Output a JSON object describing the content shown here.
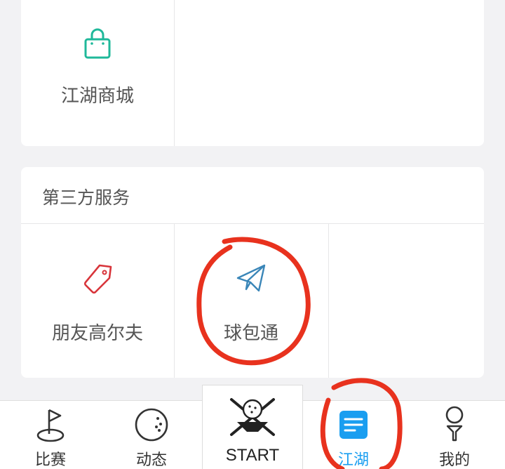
{
  "mall": {
    "label": "江湖商城",
    "icon": "shopping-bag-icon",
    "color": "#1fb89a"
  },
  "third_party": {
    "title": "第三方服务",
    "items": [
      {
        "label": "朋友高尔夫",
        "icon": "tag-icon",
        "color": "#d8343a"
      },
      {
        "label": "球包通",
        "icon": "paper-plane-icon",
        "color": "#3a86b8"
      }
    ]
  },
  "tabbar": {
    "tabs": [
      {
        "label": "比赛",
        "icon": "golf-flag-icon"
      },
      {
        "label": "动态",
        "icon": "golf-ball-icon"
      },
      {
        "label": "START",
        "icon": "golf-start-icon"
      },
      {
        "label": "江湖",
        "icon": "news-card-icon",
        "active": true
      },
      {
        "label": "我的",
        "icon": "golf-tee-icon"
      }
    ],
    "active_color": "#1a9ef0"
  },
  "annotation_color": "#e8321e"
}
